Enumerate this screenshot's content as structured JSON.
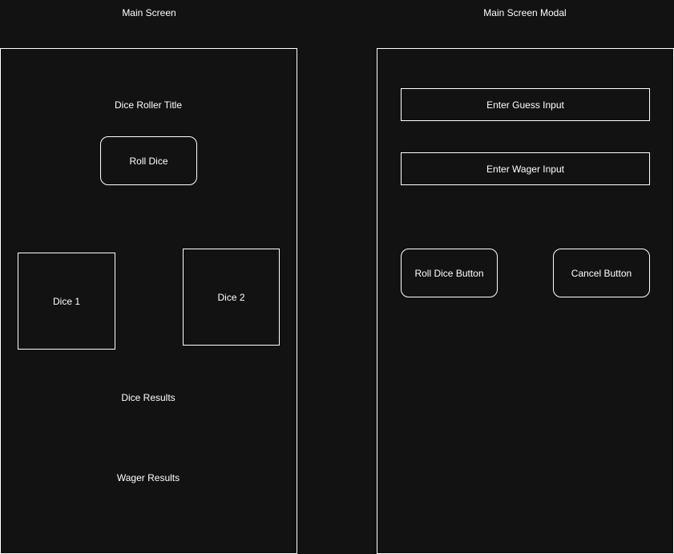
{
  "main_screen": {
    "heading": "Main Screen",
    "title": "Dice Roller Title",
    "roll_button": "Roll Dice",
    "dice_1": "Dice 1",
    "dice_2": "Dice 2",
    "dice_results": "Dice Results",
    "wager_results": "Wager Results"
  },
  "modal": {
    "heading": "Main Screen Modal",
    "guess_input": "Enter Guess Input",
    "wager_input": "Enter Wager Input",
    "roll_button": "Roll Dice Button",
    "cancel_button": "Cancel Button"
  },
  "colors": {
    "background": "#121212",
    "stroke": "#ffffff",
    "text": "#ffffff"
  }
}
